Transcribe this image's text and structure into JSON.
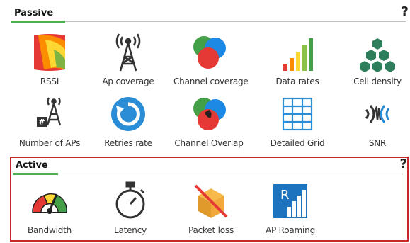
{
  "passive": {
    "title": "Passive",
    "help": "?",
    "tools": [
      {
        "label": "RSSI",
        "icon": "rssi-heatmap-icon"
      },
      {
        "label": "Ap coverage",
        "icon": "ap-tower-icon"
      },
      {
        "label": "Channel coverage",
        "icon": "channel-circles-icon"
      },
      {
        "label": "Data rates",
        "icon": "bar-rates-icon"
      },
      {
        "label": "Cell density",
        "icon": "hexagon-cells-icon"
      },
      {
        "label": "Number of APs",
        "icon": "ap-count-icon"
      },
      {
        "label": "Retries rate",
        "icon": "retry-arrow-icon"
      },
      {
        "label": "Channel Overlap",
        "icon": "channel-overlap-icon"
      },
      {
        "label": "Detailed Grid",
        "icon": "grid-icon"
      },
      {
        "label": "SNR",
        "icon": "snr-wave-icon"
      }
    ]
  },
  "active": {
    "title": "Active",
    "help": "?",
    "tools": [
      {
        "label": "Bandwidth",
        "icon": "speedometer-icon"
      },
      {
        "label": "Latency",
        "icon": "stopwatch-icon"
      },
      {
        "label": "Packet loss",
        "icon": "crossed-box-icon"
      },
      {
        "label": "AP Roaming",
        "icon": "roaming-icon"
      }
    ],
    "roaming_letter": "R",
    "grid_badge": "#"
  },
  "colors": {
    "accent": "#4caf50",
    "highlight_border": "#c62828"
  }
}
